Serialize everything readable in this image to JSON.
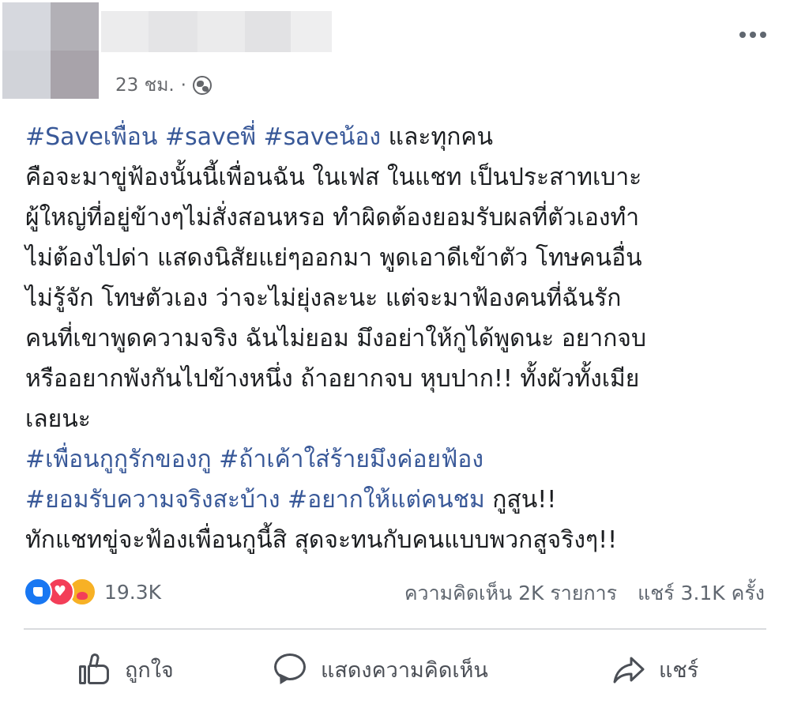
{
  "post": {
    "timestamp": "23 ชม.",
    "separator": "·",
    "lines": [
      [
        {
          "t": "#Saveเพื่อน #saveพี่ #saveน้อง",
          "tag": true
        },
        {
          "t": " และทุกคน",
          "tag": false
        }
      ],
      [
        {
          "t": "คือจะมาขู่ฟ้องนั้นนี้เพื่อนฉัน ในเฟส ในแชท เป็นประสาทเบาะ",
          "tag": false
        }
      ],
      [
        {
          "t": "ผู้ใหญ่ที่อยู่ข้างๆไม่สั่งสอนหรอ ทำผิดต้องยอมรับผลที่ตัวเองทำ",
          "tag": false
        }
      ],
      [
        {
          "t": "ไม่ต้องไปด่า แสดงนิสัยแย่ๆออกมา พูดเอาดีเข้าตัว โทษคนอื่น",
          "tag": false
        }
      ],
      [
        {
          "t": "ไม่รู้จัก โทษตัวเอง ว่าจะไม่ยุ่งละนะ แต่จะมาฟ้องคนที่ฉันรัก",
          "tag": false
        }
      ],
      [
        {
          "t": "คนที่เขาพูดความจริง ฉันไม่ยอม มึงอย่าให้กูได้พูดนะ อยากจบ",
          "tag": false
        }
      ],
      [
        {
          "t": "หรืออยากพังกันไปข้างหนึ่ง ถ้าอยากจบ หุบปาก!! ทั้งผัวทั้งเมีย",
          "tag": false
        }
      ],
      [
        {
          "t": "เลยนะ",
          "tag": false
        }
      ],
      [
        {
          "t": "#เพื่อนกูกูรักของกู #ถ้าเค้าใส่ร้ายมึงค่อยฟ้อง",
          "tag": true
        }
      ],
      [
        {
          "t": "#ยอมรับความจริงสะบ้าง #อยากให้แต่คนชม",
          "tag": true
        },
        {
          "t": " กูสูน!!",
          "tag": false
        }
      ],
      [
        {
          "t": "ทักแชทขู่จะฟ้องเพื่อนกูนี้สิ สุดจะทนกับคนแบบพวกสูจริงๆ!!",
          "tag": false
        }
      ]
    ]
  },
  "reactions": {
    "count": "19.3K",
    "icons": [
      "like-icon",
      "love-icon",
      "care-icon"
    ]
  },
  "stats": {
    "comments": "ความคิดเห็น 2K รายการ",
    "shares": "แชร์ 3.1K ครั้ง"
  },
  "actions": {
    "like": "ถูกใจ",
    "comment": "แสดงความคิดเห็น",
    "share": "แชร์"
  },
  "colors": {
    "hashtag": "#385898",
    "text": "#1c1e21",
    "muted": "#606770",
    "like_blue": "#1877f2",
    "love_red": "#f33e58",
    "care_yellow": "#f7b125"
  }
}
